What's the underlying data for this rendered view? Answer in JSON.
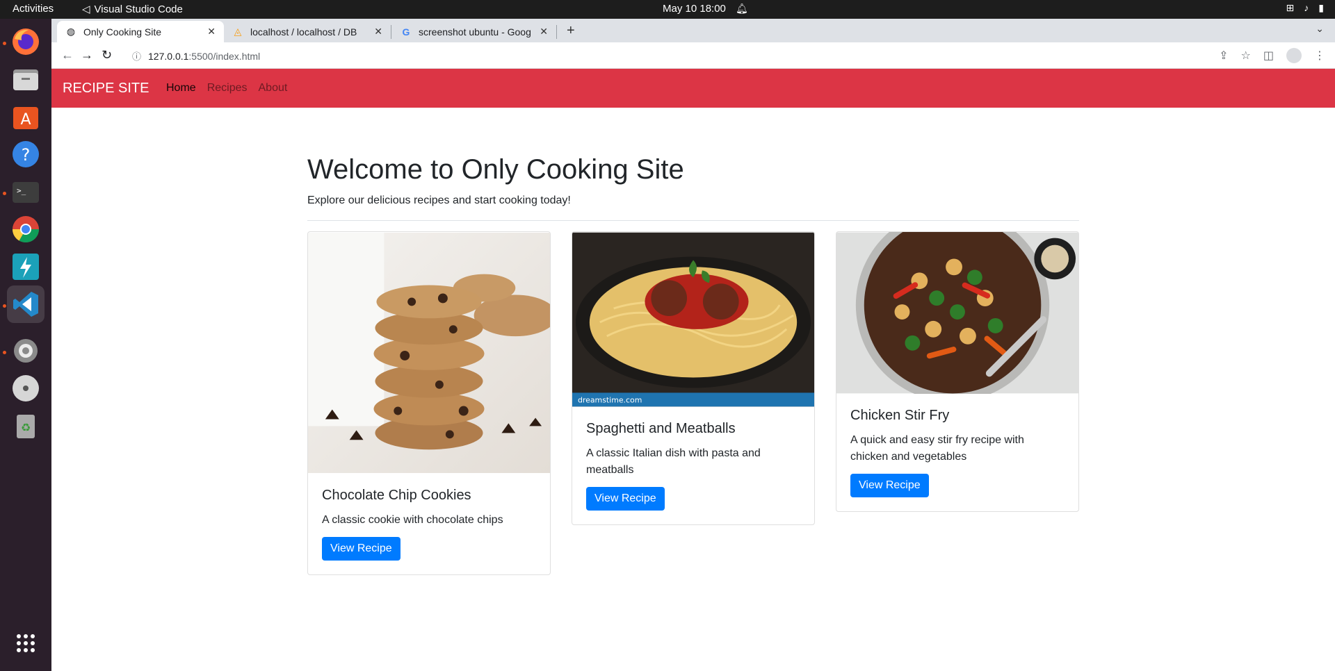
{
  "os": {
    "activities": "Activities",
    "app_name": "Visual Studio Code",
    "clock": "May 10  18:00"
  },
  "browser": {
    "tabs": [
      {
        "title": "Only Cooking Site",
        "active": true
      },
      {
        "title": "localhost / localhost / DB",
        "active": false
      },
      {
        "title": "screenshot ubuntu - Goog",
        "active": false
      }
    ],
    "url_host": "127.0.0.1",
    "url_path": ":5500/index.html"
  },
  "site": {
    "brand": "RECIPE SITE",
    "nav": [
      "Home",
      "Recipes",
      "About"
    ],
    "hero_title": "Welcome to Only Cooking Site",
    "hero_subtitle": "Explore our delicious recipes and start cooking today!",
    "cards": [
      {
        "title": "Chocolate Chip Cookies",
        "text": "A classic cookie with chocolate chips",
        "button": "View Recipe"
      },
      {
        "title": "Spaghetti and Meatballs",
        "text": "A classic Italian dish with pasta and meatballs",
        "button": "View Recipe",
        "watermark": "dreamstime.com"
      },
      {
        "title": "Chicken Stir Fry",
        "text": "A quick and easy stir fry recipe with chicken and vegetables",
        "button": "View Recipe"
      }
    ]
  },
  "colors": {
    "navbar": "#dc3545",
    "button": "#007bff",
    "dock": "#2b1f2b"
  }
}
